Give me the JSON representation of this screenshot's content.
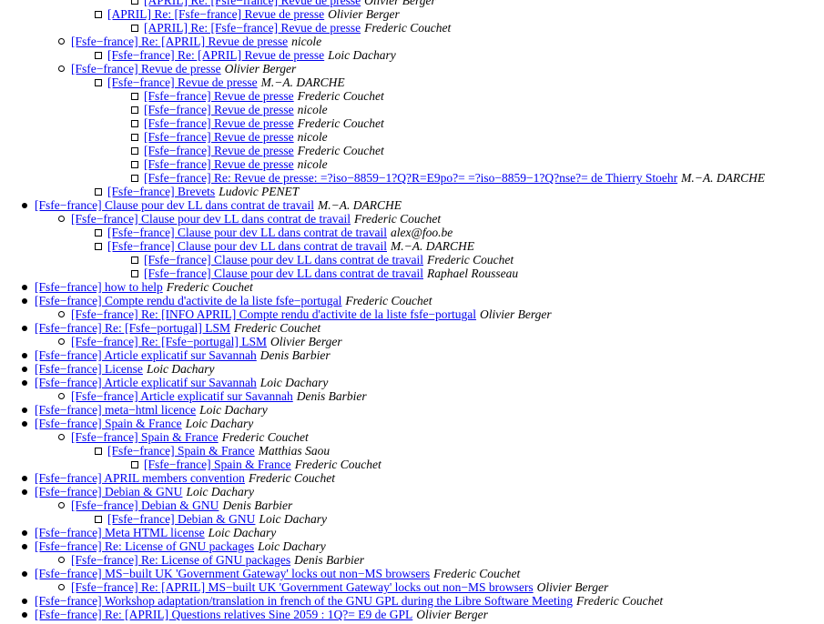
{
  "thread": [
    {
      "level": 3,
      "subject": "[APRIL] Re: [Fsfe−france] Revue de presse",
      "author": "Olivier Berger"
    },
    {
      "level": 2,
      "subject": "[APRIL] Re: [Fsfe−france] Revue de presse",
      "author": "Olivier Berger"
    },
    {
      "level": 3,
      "subject": "[APRIL] Re: [Fsfe−france] Revue de presse",
      "author": "Frederic Couchet"
    },
    {
      "level": 1,
      "subject": "[Fsfe−france] Re: [APRIL] Revue de presse",
      "author": "nicole"
    },
    {
      "level": 2,
      "subject": "[Fsfe−france] Re: [APRIL] Revue de presse",
      "author": "Loic Dachary"
    },
    {
      "level": 1,
      "subject": "[Fsfe−france] Revue de presse",
      "author": "Olivier Berger"
    },
    {
      "level": 2,
      "subject": "[Fsfe−france] Revue de presse",
      "author": "M.−A. DARCHE"
    },
    {
      "level": 3,
      "subject": "[Fsfe−france] Revue de presse",
      "author": "Frederic Couchet"
    },
    {
      "level": 3,
      "subject": "[Fsfe−france] Revue de presse",
      "author": "nicole"
    },
    {
      "level": 3,
      "subject": "[Fsfe−france] Revue de presse",
      "author": "Frederic Couchet"
    },
    {
      "level": 3,
      "subject": "[Fsfe−france] Revue de presse",
      "author": "nicole"
    },
    {
      "level": 3,
      "subject": "[Fsfe−france] Revue de presse",
      "author": "Frederic Couchet"
    },
    {
      "level": 3,
      "subject": "[Fsfe−france] Revue de presse",
      "author": "nicole"
    },
    {
      "level": 3,
      "subject": "[Fsfe−france] Re: Revue de presse: =?iso−8859−1?Q?R=E9po?= =?iso−8859−1?Q?nse?= de Thierry Stoehr",
      "author": "M.−A. DARCHE"
    },
    {
      "level": 2,
      "subject": "[Fsfe−france] Brevets",
      "author": "Ludovic PENET"
    },
    {
      "level": 0,
      "subject": "[Fsfe−france] Clause pour dev LL dans contrat de travail",
      "author": "M.−A. DARCHE"
    },
    {
      "level": 1,
      "subject": "[Fsfe−france] Clause pour dev LL dans contrat de travail",
      "author": "Frederic Couchet"
    },
    {
      "level": 2,
      "subject": "[Fsfe−france] Clause pour dev LL dans contrat de travail",
      "author": "alex@foo.be"
    },
    {
      "level": 2,
      "subject": "[Fsfe−france] Clause pour dev LL dans contrat de travail",
      "author": "M.−A. DARCHE"
    },
    {
      "level": 3,
      "subject": "[Fsfe−france] Clause pour dev LL dans contrat de travail",
      "author": "Frederic Couchet"
    },
    {
      "level": 3,
      "subject": "[Fsfe−france] Clause pour dev LL dans contrat de travail",
      "author": "Raphael Rousseau"
    },
    {
      "level": 0,
      "subject": "[Fsfe−france] how to help",
      "author": "Frederic Couchet"
    },
    {
      "level": 0,
      "subject": "[Fsfe−france] Compte rendu d'activite de la liste fsfe−portugal",
      "author": "Frederic Couchet"
    },
    {
      "level": 1,
      "subject": "[Fsfe−france] Re: [INFO APRIL] Compte rendu d'activite de la liste fsfe−portugal",
      "author": "Olivier Berger"
    },
    {
      "level": 0,
      "subject": "[Fsfe−france] Re: [Fsfe−portugal] LSM",
      "author": "Frederic Couchet"
    },
    {
      "level": 1,
      "subject": "[Fsfe−france] Re: [Fsfe−portugal] LSM",
      "author": "Olivier Berger"
    },
    {
      "level": 0,
      "subject": "[Fsfe−france] Article explicatif sur Savannah",
      "author": "Denis Barbier"
    },
    {
      "level": 0,
      "subject": "[Fsfe−france] License",
      "author": "Loic Dachary"
    },
    {
      "level": 0,
      "subject": "[Fsfe−france] Article explicatif sur Savannah",
      "author": "Loic Dachary"
    },
    {
      "level": 1,
      "subject": "[Fsfe−france] Article explicatif sur Savannah",
      "author": "Denis Barbier"
    },
    {
      "level": 0,
      "subject": "[Fsfe−france] meta−html licence",
      "author": "Loic Dachary"
    },
    {
      "level": 0,
      "subject": "[Fsfe−france] Spain & France",
      "author": "Loic Dachary"
    },
    {
      "level": 1,
      "subject": "[Fsfe−france] Spain & France",
      "author": "Frederic Couchet"
    },
    {
      "level": 2,
      "subject": "[Fsfe−france] Spain & France",
      "author": "Matthias Saou"
    },
    {
      "level": 3,
      "subject": "[Fsfe−france] Spain & France",
      "author": "Frederic Couchet"
    },
    {
      "level": 0,
      "subject": "[Fsfe−france] APRIL members convention",
      "author": "Frederic Couchet"
    },
    {
      "level": 0,
      "subject": "[Fsfe−france] Debian & GNU",
      "author": "Loic Dachary"
    },
    {
      "level": 1,
      "subject": "[Fsfe−france] Debian & GNU",
      "author": "Denis Barbier"
    },
    {
      "level": 2,
      "subject": "[Fsfe−france] Debian & GNU",
      "author": "Loic Dachary"
    },
    {
      "level": 0,
      "subject": "[Fsfe−france] Meta HTML license",
      "author": "Loic Dachary"
    },
    {
      "level": 0,
      "subject": "[Fsfe−france] Re: License of GNU packages",
      "author": "Loic Dachary"
    },
    {
      "level": 1,
      "subject": "[Fsfe−france] Re: License of GNU packages",
      "author": "Denis Barbier"
    },
    {
      "level": 0,
      "subject": "[Fsfe−france] MS−built UK 'Government Gateway' locks out non−MS browsers",
      "author": "Frederic Couchet"
    },
    {
      "level": 1,
      "subject": "[Fsfe−france] Re: [APRIL] MS−built UK 'Government Gateway' locks out non−MS browsers",
      "author": "Olivier Berger"
    },
    {
      "level": 0,
      "subject": "[Fsfe−france] Workshop adaptation/translation in french of the GNU GPL during the Libre Software Meeting",
      "author": "Frederic Couchet"
    },
    {
      "level": 0,
      "subject": "[Fsfe−france] Re: [APRIL] Questions relatives Sine 2059 : 1Q?= E9 de GPL",
      "author": "Olivier Berger"
    }
  ]
}
